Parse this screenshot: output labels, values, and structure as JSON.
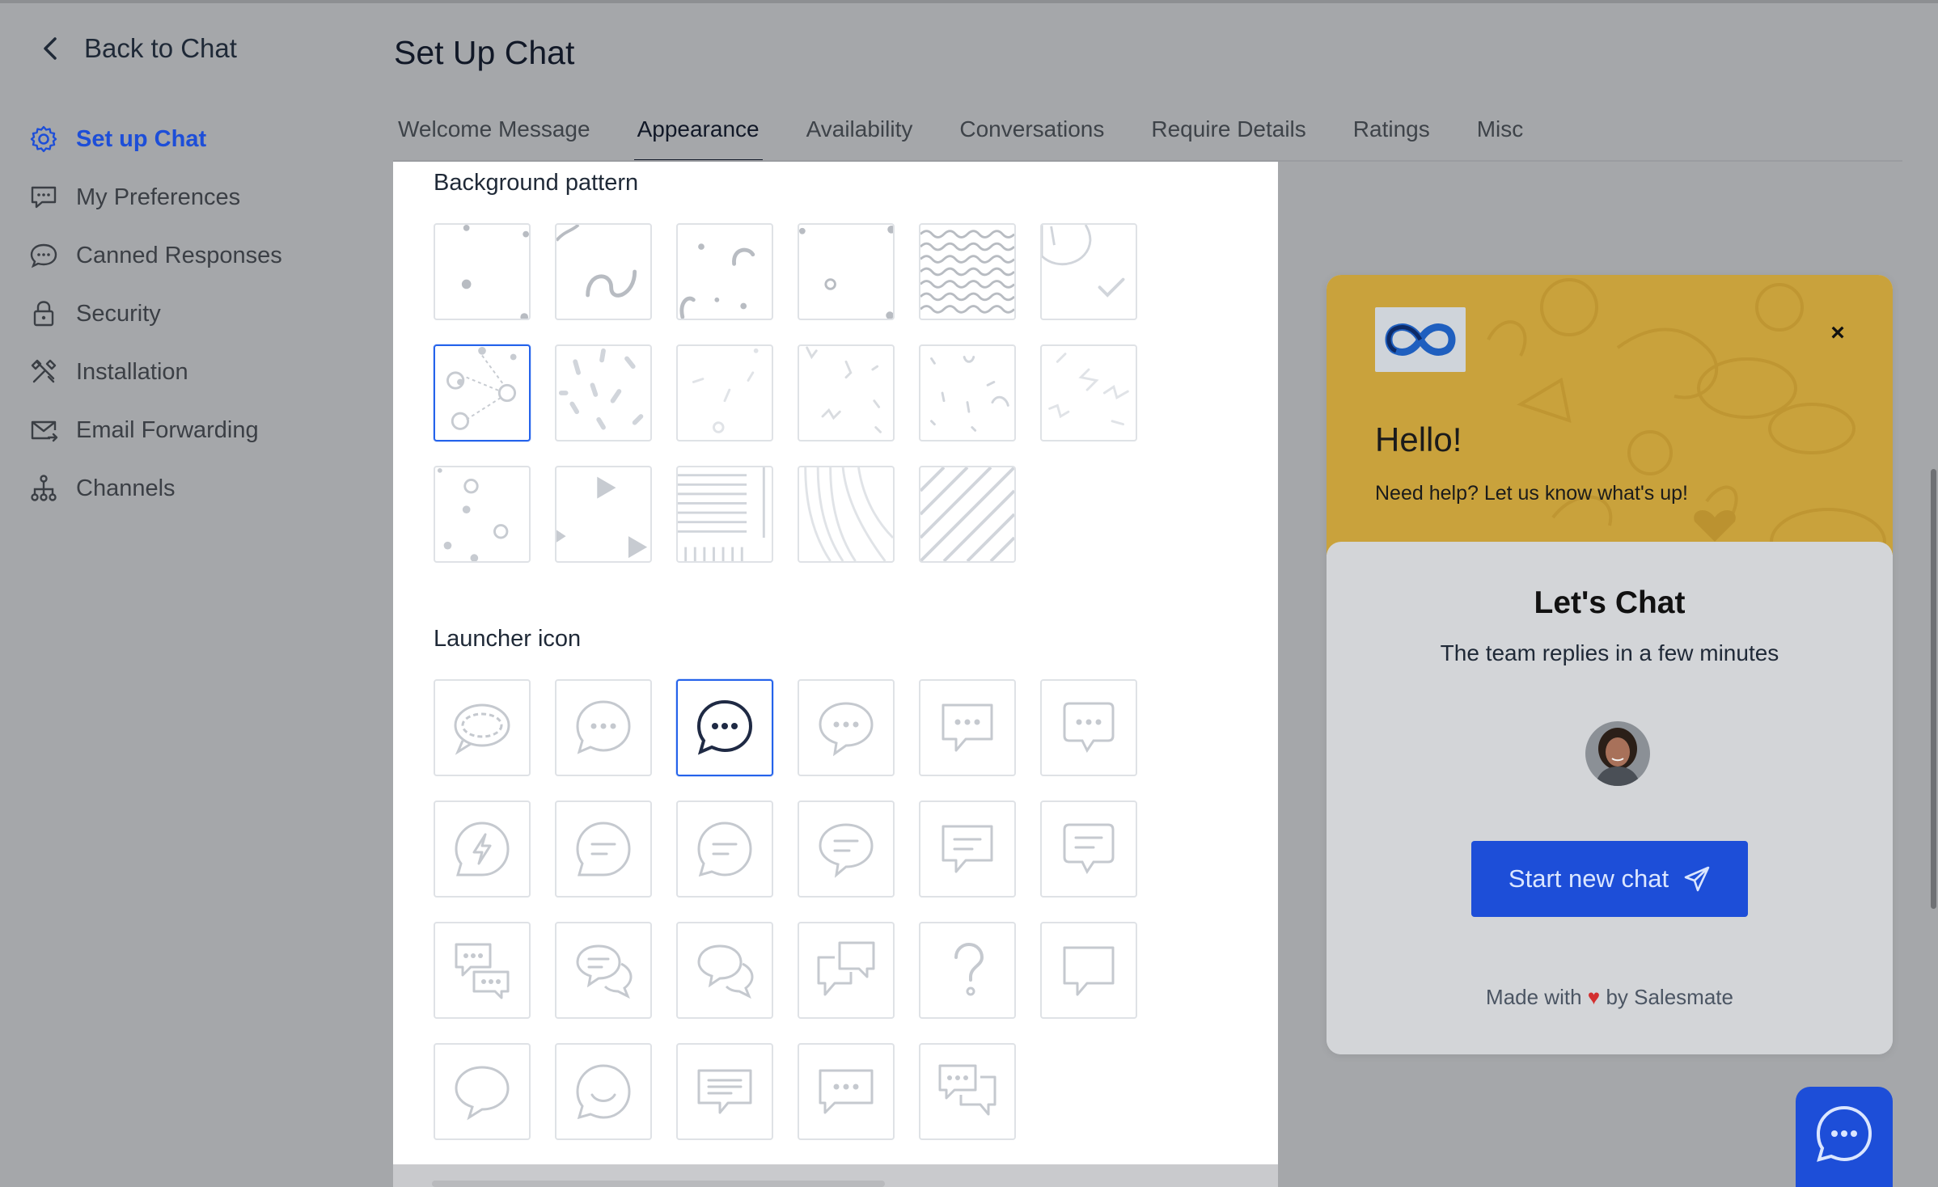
{
  "sidebar": {
    "back_label": "Back to Chat",
    "items": [
      {
        "label": "Set up Chat",
        "icon": "gear-icon",
        "active": true
      },
      {
        "label": "My Preferences",
        "icon": "chat-settings-icon"
      },
      {
        "label": "Canned Responses",
        "icon": "chat-bubble-icon"
      },
      {
        "label": "Security",
        "icon": "lock-icon"
      },
      {
        "label": "Installation",
        "icon": "tools-icon"
      },
      {
        "label": "Email Forwarding",
        "icon": "mail-forward-icon"
      },
      {
        "label": "Channels",
        "icon": "hierarchy-icon"
      }
    ]
  },
  "header": {
    "title": "Set Up Chat",
    "tabs": [
      {
        "label": "Welcome Message"
      },
      {
        "label": "Appearance",
        "active": true
      },
      {
        "label": "Availability"
      },
      {
        "label": "Conversations"
      },
      {
        "label": "Require Details"
      },
      {
        "label": "Ratings"
      },
      {
        "label": "Misc"
      }
    ]
  },
  "appearance": {
    "background_title": "Background pattern",
    "background_selected_index": 6,
    "launcher_title": "Launcher icon",
    "launcher_selected_index": 2
  },
  "preview": {
    "hello": "Hello!",
    "subtitle": "Need help? Let us know what's up!",
    "close_label": "×",
    "lets_chat": "Let's Chat",
    "reply_time": "The team replies in a few minutes",
    "start_button": "Start new chat",
    "made_with_prefix": "Made with",
    "made_with_heart": "♥",
    "made_with_suffix": "by Salesmate",
    "header_color": "#c9a23c",
    "button_color": "#1d4ed8"
  },
  "colors": {
    "accent": "#1d4ed8",
    "overlay": "#a5a7aa"
  }
}
